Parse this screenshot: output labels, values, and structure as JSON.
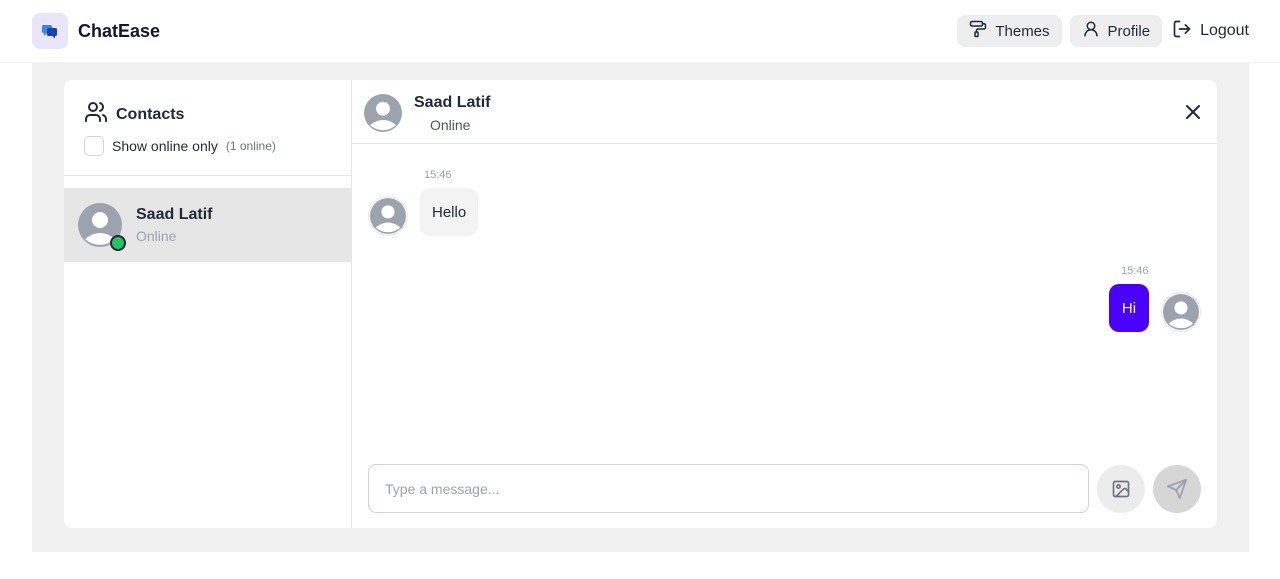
{
  "app": {
    "name": "ChatEase"
  },
  "nav": {
    "themes_label": "Themes",
    "profile_label": "Profile",
    "logout_label": "Logout"
  },
  "sidebar": {
    "title": "Contacts",
    "filter_label": "Show online only",
    "online_count": "(1 online)",
    "contacts": [
      {
        "name": "Saad Latif",
        "status": "Online",
        "online": true
      }
    ]
  },
  "chat": {
    "header": {
      "name": "Saad Latif",
      "status": "Online"
    },
    "messages": [
      {
        "direction": "incoming",
        "time": "15:46",
        "text": "Hello"
      },
      {
        "direction": "outgoing",
        "time": "15:46",
        "text": "Hi"
      }
    ],
    "composer": {
      "placeholder": "Type a message..."
    }
  },
  "colors": {
    "accent": "#4a00ff",
    "online": "#22c55e",
    "brand_bg": "#e9e6fb"
  },
  "icons": {
    "brand": "chat-bubbles-icon",
    "themes": "paint-roller-icon",
    "profile": "user-icon",
    "logout": "log-out-icon",
    "contacts": "users-icon",
    "close": "close-icon",
    "image": "image-icon",
    "send": "send-icon",
    "avatar": "user-avatar-icon"
  }
}
